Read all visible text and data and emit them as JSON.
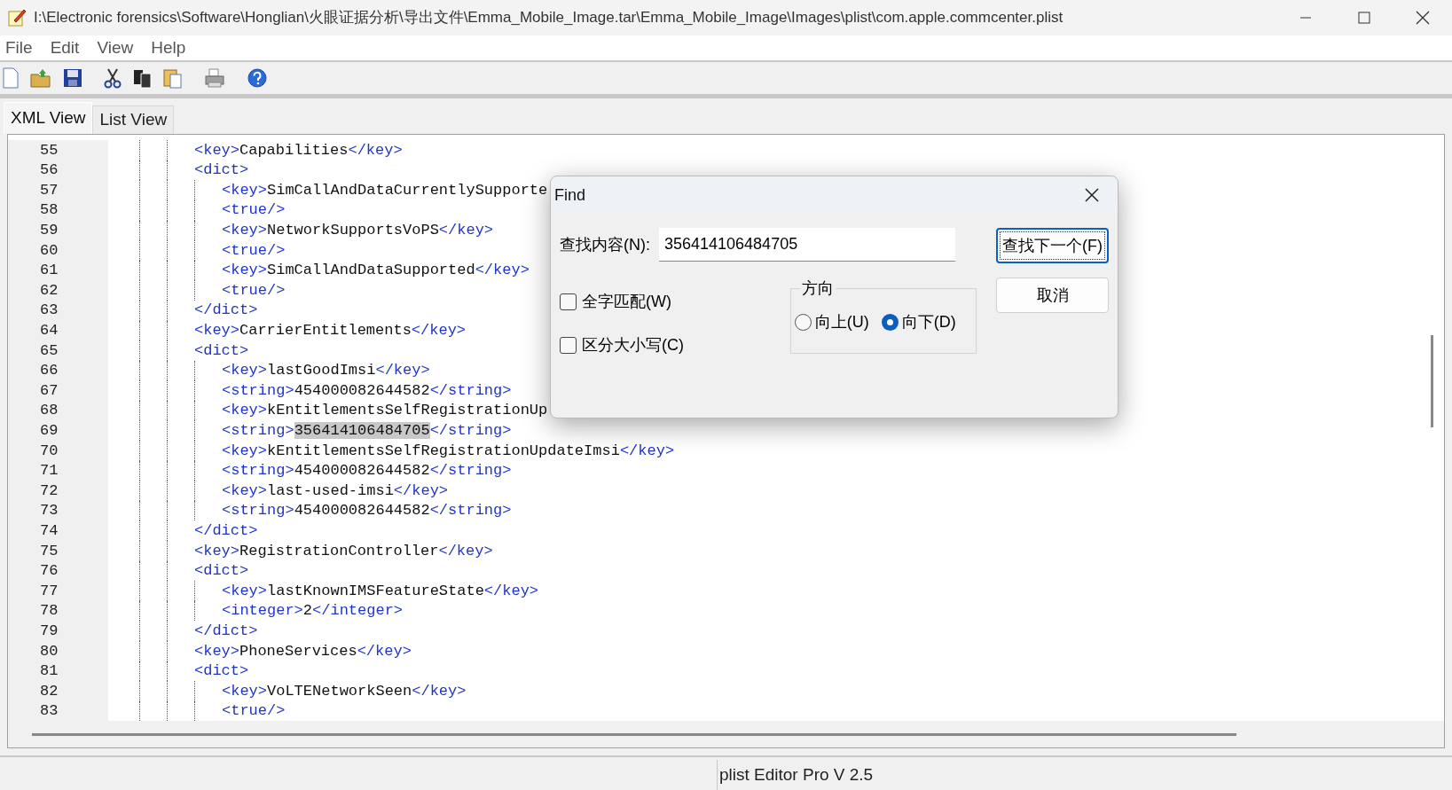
{
  "window": {
    "title": "I:\\Electronic forensics\\Software\\Honglian\\火眼证据分析\\导出文件\\Emma_Mobile_Image.tar\\Emma_Mobile_Image\\Images\\plist\\com.apple.commcenter.plist"
  },
  "menu": [
    "File",
    "Edit",
    "View",
    "Help"
  ],
  "tabs": [
    {
      "label": "XML View",
      "selected": true
    },
    {
      "label": "List View",
      "selected": false
    }
  ],
  "editor": {
    "lines": [
      {
        "number": "55",
        "open": "<key>",
        "value": "Capabilities",
        "close": "</key>"
      },
      {
        "number": "56",
        "open": "<dict>",
        "children": [
          {
            "number": "57",
            "open": "<key>",
            "value": "SimCallAndDataCurrentlySupporte"
          },
          {
            "number": "58",
            "open": "<true/>"
          },
          {
            "number": "59",
            "open": "<key>",
            "value": "NetworkSupportsVoPS",
            "close": "</key>"
          },
          {
            "number": "60",
            "open": "<true/>"
          },
          {
            "number": "61",
            "open": "<key>",
            "value": "SimCallAndDataSupported",
            "close": "</key>"
          },
          {
            "number": "62",
            "open": "<true/>"
          }
        ]
      },
      {
        "number": "63",
        "open": "</dict>"
      },
      {
        "number": "64",
        "open": "<key>",
        "value": "CarrierEntitlements",
        "close": "</key>"
      },
      {
        "number": "65",
        "open": "<dict>",
        "children": [
          {
            "number": "66",
            "open": "<key>",
            "value": "lastGoodImsi",
            "close": "</key>"
          },
          {
            "number": "67",
            "open": "<string>",
            "value": "454000082644582",
            "close": "</string>"
          },
          {
            "number": "68",
            "open": "<key>",
            "value": "kEntitlementsSelfRegistrationUp"
          },
          {
            "number": "69",
            "open": "<string>",
            "value": "356414106484705",
            "close": "</string>",
            "selected": true
          },
          {
            "number": "70",
            "open": "<key>",
            "value": "kEntitlementsSelfRegistrationUpdateImsi",
            "close": "</key>"
          },
          {
            "number": "71",
            "open": "<string>",
            "value": "454000082644582",
            "close": "</string>"
          },
          {
            "number": "72",
            "open": "<key>",
            "value": "last-used-imsi",
            "close": "</key>"
          },
          {
            "number": "73",
            "open": "<string>",
            "value": "454000082644582",
            "close": "</string>"
          }
        ]
      },
      {
        "number": "74",
        "open": "</dict>"
      },
      {
        "number": "75",
        "open": "<key>",
        "value": "RegistrationController",
        "close": "</key>"
      },
      {
        "number": "76",
        "open": "<dict>",
        "children": [
          {
            "number": "77",
            "open": "<key>",
            "value": "lastKnownIMSFeatureState",
            "close": "</key>"
          },
          {
            "number": "78",
            "open": "<integer>",
            "value": "2",
            "close": "</integer>"
          }
        ]
      },
      {
        "number": "79",
        "open": "</dict>"
      },
      {
        "number": "80",
        "open": "<key>",
        "value": "PhoneServices",
        "close": "</key>"
      },
      {
        "number": "81",
        "open": "<dict>",
        "children": [
          {
            "number": "82",
            "open": "<key>",
            "value": "VoLTENetworkSeen",
            "close": "</key>"
          },
          {
            "number": "83",
            "open": "<true/>"
          }
        ]
      }
    ]
  },
  "find_dialog": {
    "title": "Find",
    "find_label": "查找内容(N):",
    "find_value": "356414106484705",
    "options": [
      {
        "label": "全字匹配(W)",
        "checked": false
      },
      {
        "label": "区分大小写(C)",
        "checked": false
      }
    ],
    "direction": {
      "title": "方向",
      "options": [
        {
          "label": "向上(U)",
          "selected": false
        },
        {
          "label": "向下(D)",
          "selected": true
        }
      ]
    },
    "buttons": [
      {
        "label": "查找下一个(F)",
        "default": true
      },
      {
        "label": "取消",
        "default": false
      }
    ]
  },
  "status_bar": "plist Editor Pro V 2.5"
}
